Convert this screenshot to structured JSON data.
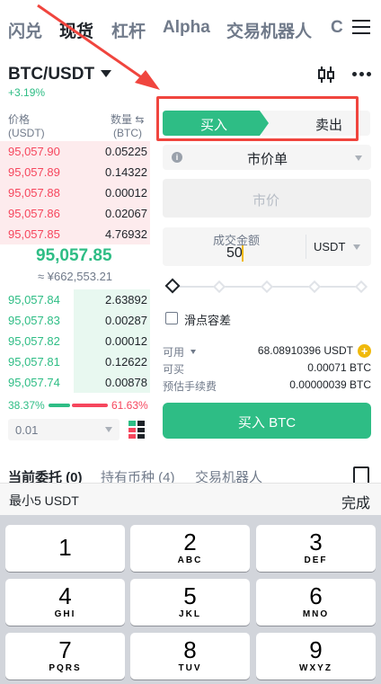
{
  "nav": {
    "tabs": [
      "闪兑",
      "现货",
      "杠杆",
      "Alpha",
      "交易机器人",
      "C"
    ],
    "active_index": 1
  },
  "pair": {
    "symbol": "BTC/USDT",
    "change": "+3.19%"
  },
  "orderbook": {
    "price_header": "价格",
    "price_unit": "(USDT)",
    "qty_header": "数量 ⇆",
    "qty_unit": "(BTC)",
    "asks": [
      {
        "price": "95,057.90",
        "qty": "0.05225",
        "depth": 1.0
      },
      {
        "price": "95,057.89",
        "qty": "0.14322",
        "depth": 1.0
      },
      {
        "price": "95,057.88",
        "qty": "0.00012",
        "depth": 1.0
      },
      {
        "price": "95,057.86",
        "qty": "0.02067",
        "depth": 1.0
      },
      {
        "price": "95,057.85",
        "qty": "4.76932",
        "depth": 1.0
      }
    ],
    "last_price": "95,057.85",
    "last_price_cny": "≈ ¥662,553.21",
    "bids": [
      {
        "price": "95,057.84",
        "qty": "2.63892",
        "depth": 0.51
      },
      {
        "price": "95,057.83",
        "qty": "0.00287",
        "depth": 0.51
      },
      {
        "price": "95,057.82",
        "qty": "0.00012",
        "depth": 0.51
      },
      {
        "price": "95,057.81",
        "qty": "0.12622",
        "depth": 0.51
      },
      {
        "price": "95,057.74",
        "qty": "0.00878",
        "depth": 0.51
      }
    ],
    "buy_ratio": "38.37%",
    "sell_ratio": "61.63%",
    "depth_value": "0.01"
  },
  "trade": {
    "buy_label": "买入",
    "sell_label": "卖出",
    "order_type": "市价单",
    "price_placeholder": "市价",
    "amount_label": "成交金额",
    "amount_value": "50",
    "amount_unit": "USDT",
    "slippage_label": "滑点容差",
    "available_label": "可用",
    "available_value": "68.08910396 USDT",
    "can_buy_label": "可买",
    "can_buy_value": "0.00071 BTC",
    "fee_label": "预估手续费",
    "fee_value": "0.00000039 BTC",
    "submit_label": "买入 BTC"
  },
  "bottom_tabs": [
    "当前委托 (0)",
    "持有币种 (4)",
    "交易机器人"
  ],
  "keyboard": {
    "hint": "最小5 USDT",
    "done": "完成",
    "keys": [
      {
        "n": "1",
        "l": ""
      },
      {
        "n": "2",
        "l": "ABC"
      },
      {
        "n": "3",
        "l": "DEF"
      },
      {
        "n": "4",
        "l": "GHI"
      },
      {
        "n": "5",
        "l": "JKL"
      },
      {
        "n": "6",
        "l": "MNO"
      },
      {
        "n": "7",
        "l": "PQRS"
      },
      {
        "n": "8",
        "l": "TUV"
      },
      {
        "n": "9",
        "l": "WXYZ"
      }
    ]
  },
  "colors": {
    "green": "#2ebd85",
    "red": "#f6465d",
    "highlight": "#f0453e"
  }
}
